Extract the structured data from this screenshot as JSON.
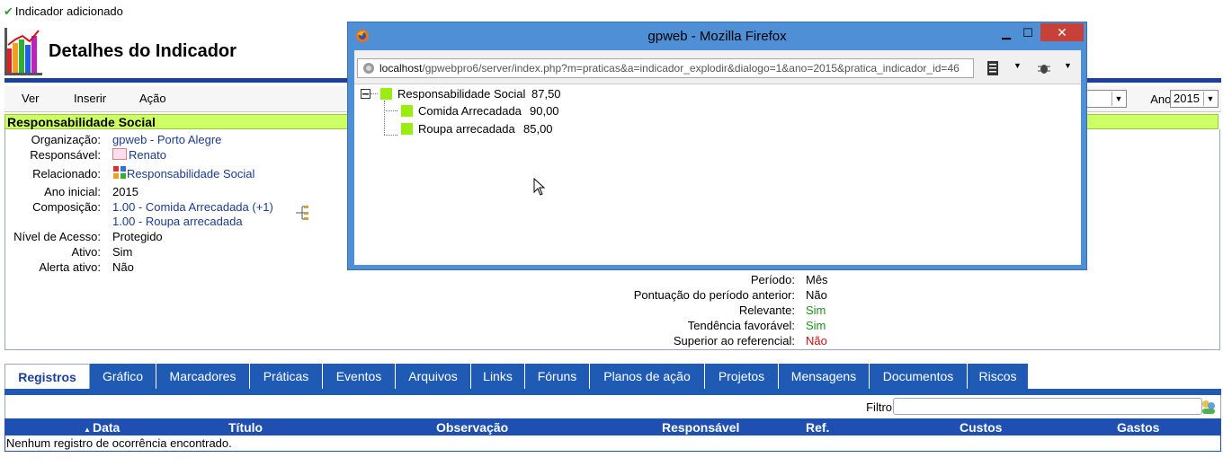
{
  "notice": "Indicador adicionado",
  "page_title": "Detalhes do Indicador",
  "menu": {
    "items": [
      "Ver",
      "Inserir",
      "Ação"
    ],
    "ano_label": "Ano:",
    "ano_value": "2015"
  },
  "section_title": "Responsabilidade Social",
  "details_left": [
    {
      "label": "Organização:",
      "value": "gpweb - Porto Alegre"
    },
    {
      "label": "Responsável:",
      "value": "Renato"
    },
    {
      "label": "Relacionado:",
      "value": "Responsabilidade Social"
    },
    {
      "label": "Ano inicial:",
      "value": "2015"
    },
    {
      "label": "Composição:",
      "value": "1.00 - Comida Arrecadada (+1)"
    },
    {
      "label": "",
      "value": "1.00 - Roupa arrecadada"
    },
    {
      "label": "Nível de Acesso:",
      "value": "Protegido"
    },
    {
      "label": "Ativo:",
      "value": "Sim"
    },
    {
      "label": "Alerta ativo:",
      "value": "Não"
    }
  ],
  "details_right": [
    {
      "label": "Período:",
      "value": "Mês"
    },
    {
      "label": "Pontuação do período anterior:",
      "value": "Não"
    },
    {
      "label": "Relevante:",
      "value": "Sim"
    },
    {
      "label": "Tendência favorável:",
      "value": "Sim"
    },
    {
      "label": "Superior ao referencial:",
      "value": "Não"
    }
  ],
  "colors": {
    "brand_blue": "#1f5bb4",
    "section_green": "#ccff66",
    "tree_square": "#99ee11",
    "positive": "#1f8f1f",
    "negative": "#cc1111"
  },
  "tabs": [
    "Registros",
    "Gráfico",
    "Marcadores",
    "Práticas",
    "Eventos",
    "Arquivos",
    "Links",
    "Fóruns",
    "Planos de ação",
    "Projetos",
    "Mensagens",
    "Documentos",
    "Riscos"
  ],
  "table": {
    "filter_label": "Filtro",
    "columns": [
      "Data",
      "Título",
      "Observação",
      "Responsável",
      "Ref.",
      "Custos",
      "Gastos"
    ],
    "empty_message": "Nenhum registro de ocorrência encontrado."
  },
  "popup": {
    "title": "gpweb - Mozilla Firefox",
    "url_host": "localhost",
    "url_path": "/gpwebpro6/server/index.php?m=praticas&a=indicador_explodir&dialogo=1&ano=2015&pratica_indicador_id=46",
    "tree": [
      {
        "label": "Responsabilidade Social",
        "value": "87,50"
      },
      {
        "label": "Comida Arrecadada",
        "value": "90,00"
      },
      {
        "label": "Roupa arrecadada",
        "value": "85,00"
      }
    ]
  }
}
